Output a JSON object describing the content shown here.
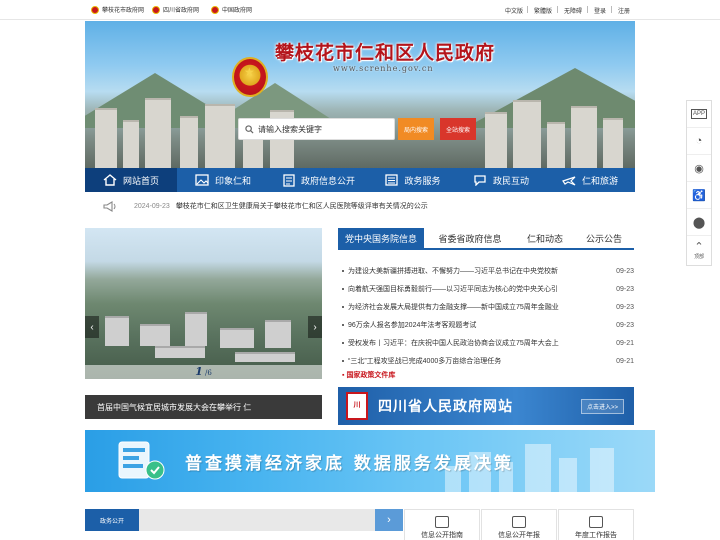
{
  "topbar": {
    "links": [
      "攀枝花市政府网",
      "四川省政府网",
      "中国政府网"
    ],
    "right": [
      "中文版",
      "繁體版",
      "无障碍",
      "登录",
      "注册"
    ]
  },
  "banner": {
    "title": "攀枝花市仁和区人民政府",
    "url": "www.screnhe.gov.cn",
    "search_placeholder": "请输入搜索关键字",
    "site_search": "局内搜索",
    "all_search": "全站搜索"
  },
  "nav": [
    {
      "label": "网站首页",
      "icon": "home-icon"
    },
    {
      "label": "印象仁和",
      "icon": "image-icon"
    },
    {
      "label": "政府信息公开",
      "icon": "document-icon"
    },
    {
      "label": "政务服务",
      "icon": "list-icon"
    },
    {
      "label": "政民互动",
      "icon": "chat-icon"
    },
    {
      "label": "仁和旅游",
      "icon": "plane-icon"
    }
  ],
  "notice": {
    "date": "2024-09-23",
    "text": "攀枝花市仁和区卫生健康局关于攀枝花市仁和区人民医院等级评审有关情况的公示"
  },
  "slider": {
    "current": "1",
    "total": "/6",
    "caption": "首届中国气候宜居城市发展大会在攀举行 仁"
  },
  "news": {
    "tabs": [
      "党中央国务院信息",
      "省委省政府信息",
      "仁和动态",
      "公示公告"
    ],
    "items": [
      {
        "title": "为建设大美新疆拼搏进取、不懈努力——习近平总书记在中央党校新",
        "date": "09-23"
      },
      {
        "title": "向着航天强国目标勇毅前行——以习近平同志为核心的党中央关心引",
        "date": "09-23"
      },
      {
        "title": "为经济社会发展大局提供有力金融支撑——新中国成立75周年金融业",
        "date": "09-23"
      },
      {
        "title": "96万余人报名参加2024年法考客观题考试",
        "date": "09-23"
      },
      {
        "title": "受权发布丨习近平：在庆祝中国人民政治协商会议成立75周年大会上",
        "date": "09-21"
      },
      {
        "title": "“三北”工程攻坚战已完成4000多万亩综合治理任务",
        "date": "09-21"
      }
    ],
    "policy_link": "国家政策文件库"
  },
  "sichuan": {
    "seal": "四川省人民政府",
    "name": "四川省人民政府网站",
    "enter": "点击进入>>"
  },
  "promo": {
    "text": "普查摸清经济家底 数据服务发展决策"
  },
  "bottom": {
    "tab": "政务公开",
    "cards": [
      "信息公开指南",
      "信息公开年报",
      "年度工作报告"
    ]
  },
  "sidetools": [
    {
      "icon": "app-icon",
      "label": "APP"
    },
    {
      "icon": "wechat-icon",
      "label": ""
    },
    {
      "icon": "weibo-icon",
      "label": ""
    },
    {
      "icon": "accessibility-icon",
      "label": ""
    },
    {
      "icon": "location-icon",
      "label": ""
    },
    {
      "icon": "back-to-top-icon",
      "label": "顶部"
    }
  ],
  "colors": {
    "brand_blue": "#1c5fa8",
    "brand_red": "#c8161d",
    "orange": "#f18b24",
    "red_btn": "#d9362b"
  }
}
